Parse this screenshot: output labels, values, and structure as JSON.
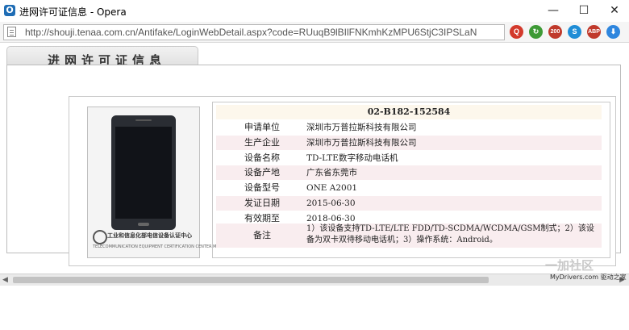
{
  "window": {
    "title": "进网许可证信息 - Opera",
    "app_icon_glyph": "O",
    "controls": {
      "minimize": "—",
      "maximize": "☐",
      "close": "✕"
    }
  },
  "address_bar": {
    "url": "http://shouji.tenaa.com.cn/Antifake/LoginWebDetail.aspx?code=RUuqB9lBIlFNKmhKzMPU6StjC3IPSLaN",
    "toolbar_icons": [
      {
        "name": "opera-search-icon",
        "glyph": "Q",
        "color": "#d33a2c"
      },
      {
        "name": "refresh-addon-icon",
        "glyph": "↻",
        "color": "#3e9a36"
      },
      {
        "name": "rss-count-icon",
        "glyph": "200",
        "color": "#c0392b"
      },
      {
        "name": "skype-icon",
        "glyph": "S",
        "color": "#1f8dd6"
      },
      {
        "name": "adblock-icon",
        "glyph": "ABP",
        "color": "#c0392b"
      },
      {
        "name": "download-icon",
        "glyph": "⬇",
        "color": "#2e86de"
      }
    ]
  },
  "page": {
    "tab_title": "进网许可证信息",
    "photo": {
      "cert_org": "工业和信息化部电信设备认证中心",
      "cert_org_en": "TELECOMMUNICATION EQUIPMENT CERTIFICATION CENTER MIIT"
    },
    "license_code": "02-B182-152584",
    "fields": [
      {
        "label": "申请单位",
        "value": "深圳市万普拉斯科技有限公司"
      },
      {
        "label": "生产企业",
        "value": "深圳市万普拉斯科技有限公司"
      },
      {
        "label": "设备名称",
        "value": "TD-LTE数字移动电话机"
      },
      {
        "label": "设备产地",
        "value": "广东省东莞市"
      },
      {
        "label": "设备型号",
        "value": "ONE A2001"
      },
      {
        "label": "发证日期",
        "value": "2015-06-30"
      },
      {
        "label": "有效期至",
        "value": "2018-06-30"
      }
    ],
    "remark": {
      "label": "备注",
      "value": "1）该设备支持TD-LTE/LTE FDD/TD-SCDMA/WCDMA/GSM制式；2）该设备为双卡双待移动电话机；3）操作系统：Android。"
    }
  },
  "watermark": {
    "main": "一加社区",
    "sub": "MyDrivers.com 驱动之家"
  }
}
